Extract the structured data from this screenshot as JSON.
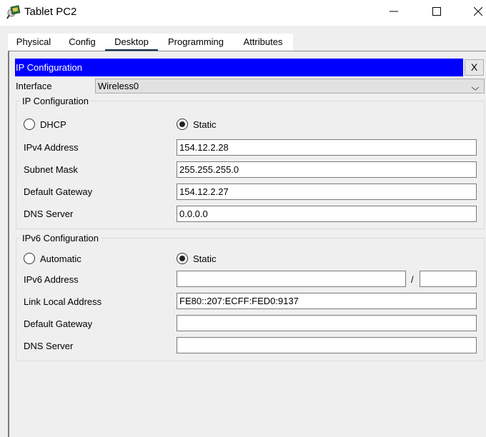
{
  "window": {
    "title": "Tablet PC2",
    "app_icon": "tablet-pc-icon",
    "controls": {
      "minimize": "minimize-icon",
      "maximize": "maximize-icon",
      "close": "close-icon"
    }
  },
  "tabs": [
    {
      "label": "Physical",
      "active": false
    },
    {
      "label": "Config",
      "active": false
    },
    {
      "label": "Desktop",
      "active": true
    },
    {
      "label": "Programming",
      "active": false
    },
    {
      "label": "Attributes",
      "active": false
    }
  ],
  "app": {
    "header_title": "IP Configuration",
    "header_color": "#0000ff",
    "close_label": "X",
    "interface_label": "Interface",
    "interface_value": "Wireless0"
  },
  "ipv4": {
    "legend": "IP Configuration",
    "mode_options": [
      {
        "label": "DHCP",
        "checked": false
      },
      {
        "label": "Static",
        "checked": true
      }
    ],
    "fields": [
      {
        "label": "IPv4 Address",
        "value": "154.12.2.28"
      },
      {
        "label": "Subnet Mask",
        "value": "255.255.255.0"
      },
      {
        "label": "Default Gateway",
        "value": "154.12.2.27"
      },
      {
        "label": "DNS Server",
        "value": "0.0.0.0"
      }
    ]
  },
  "ipv6": {
    "legend": "IPv6 Configuration",
    "mode_options": [
      {
        "label": "Automatic",
        "checked": false
      },
      {
        "label": "Static",
        "checked": true
      }
    ],
    "address_label": "IPv6 Address",
    "address_value": "",
    "prefix_separator": "/",
    "prefix_value": "",
    "fields": [
      {
        "label": "Link Local Address",
        "value": "FE80::207:ECFF:FED0:9137"
      },
      {
        "label": "Default Gateway",
        "value": ""
      },
      {
        "label": "DNS Server",
        "value": ""
      }
    ]
  }
}
